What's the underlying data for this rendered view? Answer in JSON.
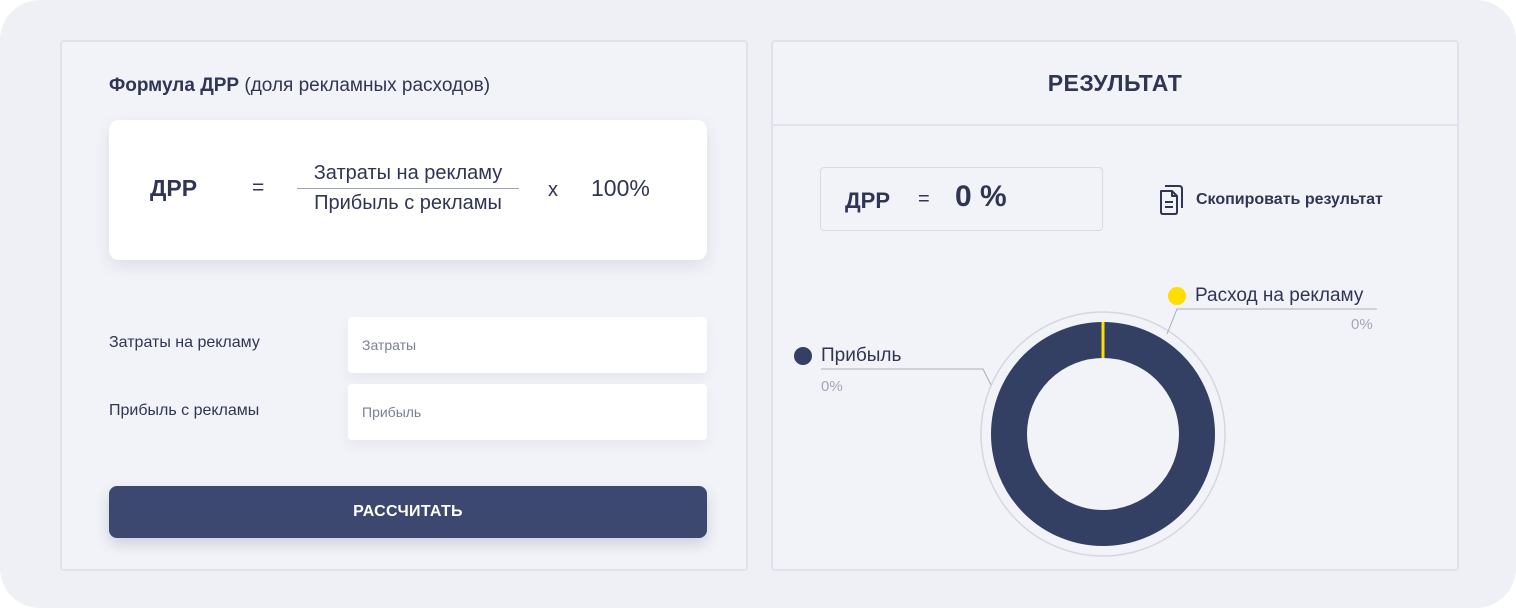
{
  "formula": {
    "heading_bold": "Формула ДРР",
    "heading_rest": "(доля рекламных расходов)",
    "lhs": "ДРР",
    "eq": "=",
    "numerator": "Затраты на рекламу",
    "denominator": "Прибыль с рекламы",
    "times": "x",
    "multiplier": "100%"
  },
  "fields": [
    {
      "label": "Затраты на рекламу",
      "placeholder": "Затраты",
      "value": ""
    },
    {
      "label": "Прибыль с рекламы",
      "placeholder": "Прибыль",
      "value": ""
    }
  ],
  "calculate_label": "РАССЧИТАТЬ",
  "result": {
    "title": "РЕЗУЛЬТАТ",
    "lhs": "ДРР",
    "eq": "=",
    "value": "0 %",
    "copy_label": "Скопировать результат",
    "copy_icon": "copy-document-icon"
  },
  "chart_data": {
    "type": "pie",
    "donut": true,
    "categories": [
      "Расход на рекламу",
      "Прибыль"
    ],
    "values": [
      0,
      100
    ],
    "labels": [
      "0%",
      "0%"
    ],
    "colors": [
      "#ffdd00",
      "#333f63"
    ]
  },
  "legend": [
    {
      "label": "Расход на рекламу",
      "pct": "0%",
      "color": "#ffdd00"
    },
    {
      "label": "Прибыль",
      "pct": "0%",
      "color": "#333f63"
    }
  ]
}
